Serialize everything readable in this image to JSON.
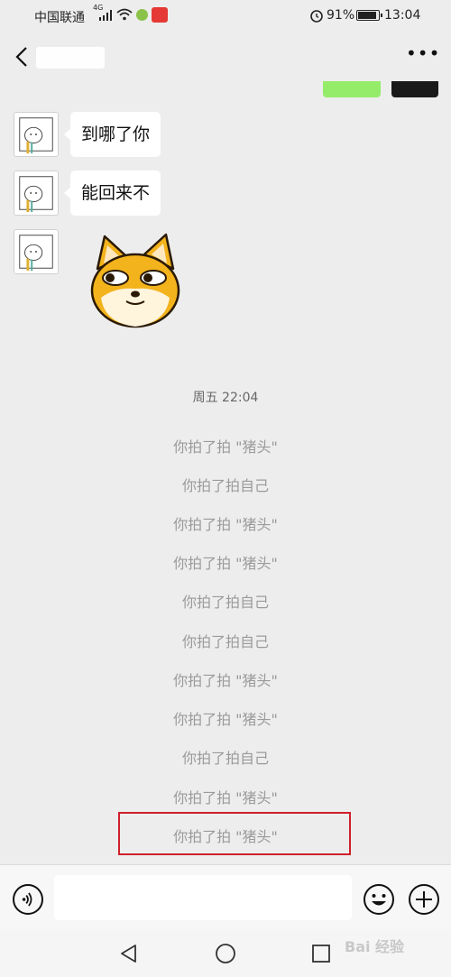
{
  "status_bar": {
    "carrier": "中国联通",
    "network": "4G",
    "battery_percent": "91%",
    "time": "13:04"
  },
  "nav": {
    "back_icon": "chevron-left-icon",
    "more_icon": "ellipsis-icon",
    "more_label": "•••"
  },
  "messages": [
    {
      "sender": "contact",
      "type": "text",
      "text": "到哪了你"
    },
    {
      "sender": "contact",
      "type": "text",
      "text": "能回来不"
    },
    {
      "sender": "contact",
      "type": "sticker",
      "sticker": "shiba-dog-side-eye-sticker"
    }
  ],
  "timestamp": "周五 22:04",
  "pat_notices": [
    "你拍了拍 \"猪头\"",
    "你拍了拍自己",
    "你拍了拍 \"猪头\"",
    "你拍了拍 \"猪头\"",
    "你拍了拍自己",
    "你拍了拍自己",
    "你拍了拍 \"猪头\"",
    "你拍了拍 \"猪头\"",
    "你拍了拍自己",
    "你拍了拍 \"猪头\"",
    "你拍了拍 \"猪头\""
  ],
  "highlight_color": "#d0202b",
  "input_bar": {
    "voice_icon": "voice-icon",
    "input_value": "",
    "emoji_icon": "smiley-icon",
    "plus_icon": "plus-icon"
  },
  "system_nav": {
    "back_icon": "triangle-back-icon",
    "home_icon": "circle-home-icon",
    "recent_icon": "square-recent-icon"
  },
  "watermark": "Bai 经验"
}
